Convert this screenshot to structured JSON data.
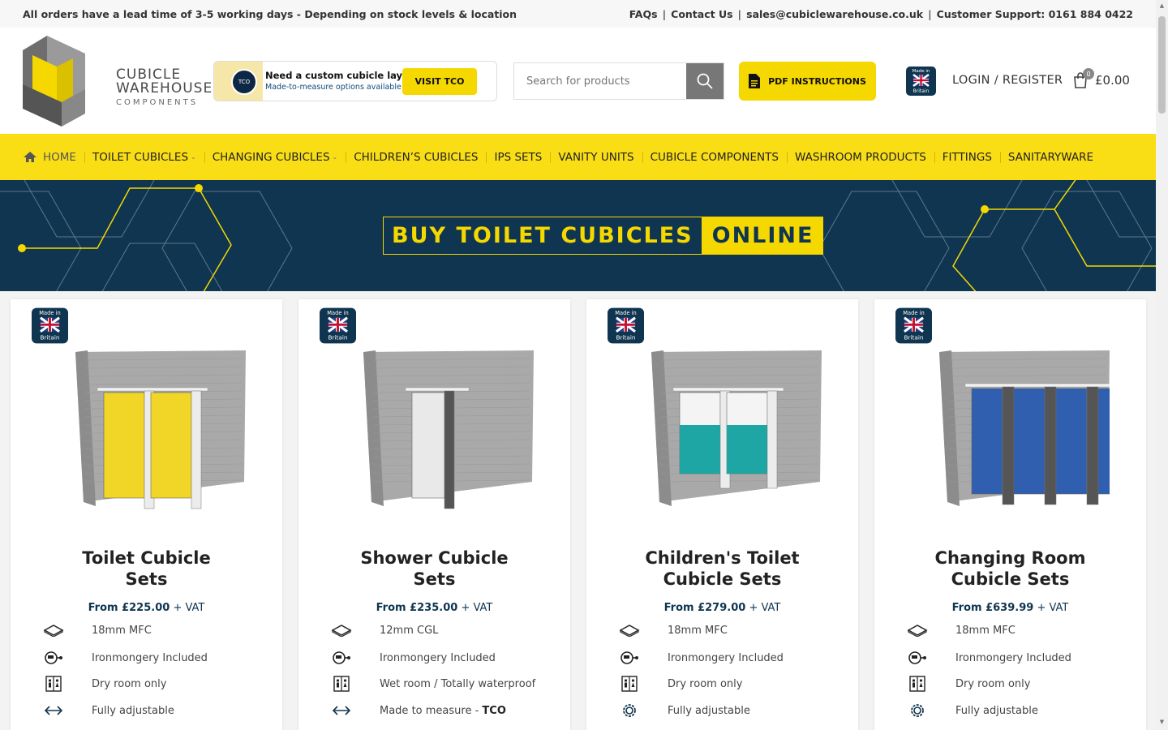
{
  "topbar": {
    "notice": "All orders have a lead time of 3-5 working days - Depending on stock levels & location",
    "faqs": "FAQs",
    "contact": "Contact Us",
    "email": "sales@cubiclewarehouse.co.uk",
    "support": "Customer Support: 0161 884 0422"
  },
  "logo": {
    "line1": "CUBICLE",
    "line2": "WAREHOUSE",
    "line3": "COMPONENTS"
  },
  "tco": {
    "logo_text": "TCO",
    "heading": "Need a custom cubicle layout?",
    "sub": "Made-to-measure options available",
    "button": "VISIT TCO"
  },
  "search": {
    "placeholder": "Search for products"
  },
  "pdf_button": "PDF INSTRUCTIONS",
  "made_in": {
    "line1": "Made in",
    "line2": "Britain"
  },
  "account": {
    "login": "LOGIN / REGISTER"
  },
  "cart": {
    "count": "0",
    "total": "£0.00"
  },
  "nav": {
    "items": [
      {
        "label": "HOME"
      },
      {
        "label": "TOILET CUBICLES"
      },
      {
        "label": "CHANGING CUBICLES"
      },
      {
        "label": "CHILDREN’S CUBICLES"
      },
      {
        "label": "IPS SETS"
      },
      {
        "label": "VANITY UNITS"
      },
      {
        "label": "CUBICLE COMPONENTS"
      },
      {
        "label": "WASHROOM PRODUCTS"
      },
      {
        "label": "FITTINGS"
      },
      {
        "label": "SANITARYWARE"
      }
    ]
  },
  "hero": {
    "title_a": "BUY TOILET CUBICLES",
    "title_b": "ONLINE"
  },
  "products": [
    {
      "title_line1": "Toilet Cubicle",
      "title_line2": "Sets",
      "price": "From £225.00",
      "vat": " + VAT",
      "door_color": "#f2d627",
      "features": [
        "18mm MFC",
        "Ironmongery Included",
        "Dry room only",
        "Fully adjustable"
      ]
    },
    {
      "title_line1": "Shower Cubicle",
      "title_line2": "Sets",
      "price": "From £235.00",
      "vat": " + VAT",
      "door_color": "#e9e9e9",
      "features": [
        "12mm CGL",
        "Ironmongery Included",
        "Wet room / Totally waterproof",
        "Made to measure - "
      ],
      "feature4_bold": "TCO"
    },
    {
      "title_line1": "Children's Toilet",
      "title_line2": "Cubicle Sets",
      "price": "From £279.00",
      "vat": " + VAT",
      "door_color": "#1ea6a4",
      "features": [
        "18mm MFC",
        "Ironmongery Included",
        "Dry room only",
        "Fully adjustable"
      ]
    },
    {
      "title_line1": "Changing Room",
      "title_line2": "Cubicle Sets",
      "price": "From £639.99",
      "vat": " + VAT",
      "door_color": "#2f5fae",
      "features": [
        "18mm MFC",
        "Ironmongery Included",
        "Dry room only",
        "Fully adjustable"
      ]
    }
  ],
  "colors": {
    "accent_yellow": "#f9de16",
    "navy": "#0f3550"
  }
}
